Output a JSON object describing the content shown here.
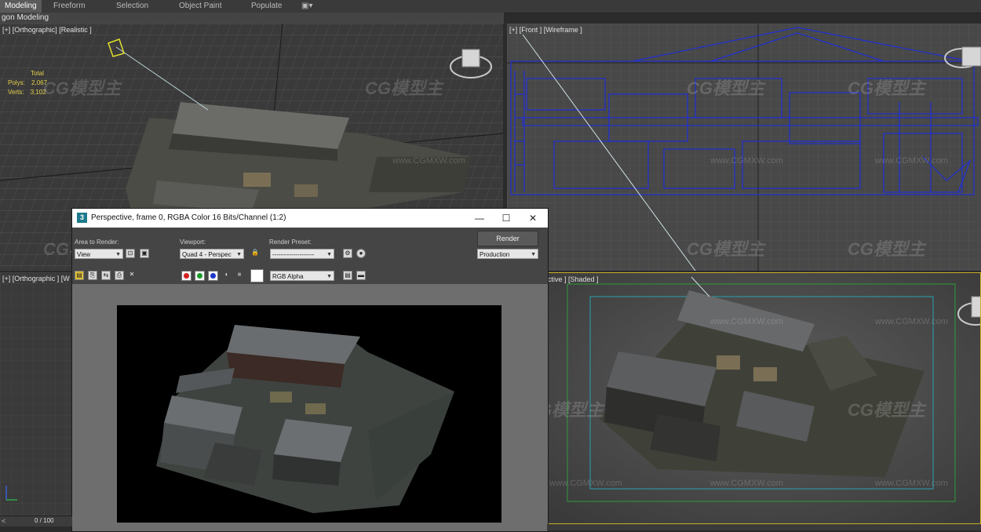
{
  "ribbon": {
    "tabs": [
      "Modeling",
      "Freeform",
      "Selection",
      "Object Paint",
      "Populate"
    ],
    "active_tab": "Modeling",
    "subtitle": "gon Modeling"
  },
  "viewports": {
    "top_left": {
      "label": "[+] [Orthographic] [Realistic ]",
      "stats": {
        "total_label": "Total",
        "polys_label": "Polys:",
        "polys_value": "2,067",
        "verts_label": "Verts:",
        "verts_value": "3,102"
      }
    },
    "top_right": {
      "label": "[+] [Front ] [Wireframe ]"
    },
    "bottom_left": {
      "label": "[+] [Orthographic ] [W"
    },
    "bottom_right": {
      "label": "ctive ] [Shaded ]"
    }
  },
  "watermarks": {
    "logo": "CG模型主",
    "url": "www.CGMXW.com"
  },
  "render_frame": {
    "title": "Perspective, frame 0, RGBA Color 16 Bits/Channel (1:2)",
    "logo_letter": "3",
    "area_label": "Area to Render:",
    "area_value": "View",
    "viewport_label": "Viewport:",
    "viewport_value": "Quad 4 - Perspec",
    "preset_label": "Render Preset:",
    "preset_value": "--------------------",
    "render_button": "Render",
    "mode_value": "Production",
    "channel_value": "RGB Alpha",
    "minimize": "—",
    "maximize": "☐",
    "close": "✕"
  },
  "timeline": {
    "frame_text": "0 / 100"
  },
  "colors": {
    "wireframe": "#1f2fd6",
    "safe_frame_outer": "#c9b227",
    "safe_frame_mid": "#2f9a3c",
    "safe_frame_inner": "#2aa0b0",
    "stats": "#e6d24a"
  }
}
